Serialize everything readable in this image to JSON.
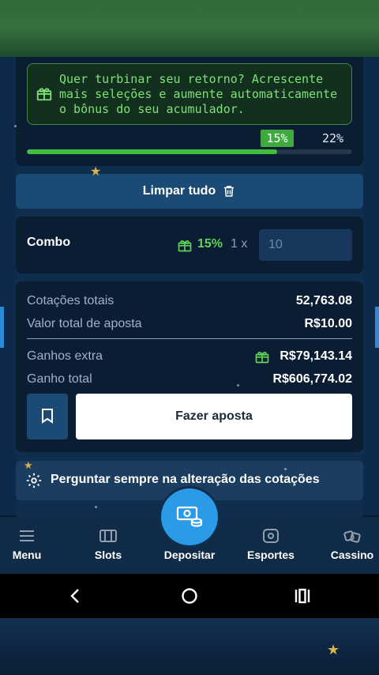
{
  "promo": {
    "message": "Quer turbinar seu retorno? Acrescente mais seleções e aumente automaticamente o bônus do seu acumulador.",
    "current_percent": "15%",
    "max_percent": "22%",
    "progress": 0.77
  },
  "actions": {
    "clear_all": "Limpar tudo"
  },
  "combo": {
    "label": "Combo",
    "bonus_percent": "15%",
    "multiplier": "1 x",
    "stake_placeholder": "10"
  },
  "summary": {
    "total_odds_label": "Cotações totais",
    "total_odds_value": "52,763.08",
    "total_stake_label": "Valor total de aposta",
    "total_stake_value": "R$10.00",
    "extra_winnings_label": "Ganhos extra",
    "extra_winnings_value": "R$79,143.14",
    "total_win_label": "Ganho total",
    "total_win_value": "R$606,774.02",
    "place_bet_label": "Fazer aposta"
  },
  "settings": {
    "odds_change_label": "Perguntar sempre na alteração das cotações"
  },
  "nav": {
    "items": [
      {
        "label": "Menu",
        "icon": "menu-icon"
      },
      {
        "label": "Slots",
        "icon": "slots-icon"
      },
      {
        "label": "Depositar",
        "icon": "deposit-icon"
      },
      {
        "label": "Esportes",
        "icon": "sports-icon"
      },
      {
        "label": "Cassino",
        "icon": "casino-icon"
      }
    ]
  },
  "colors": {
    "accent_green": "#3fbf3d",
    "primary_blue": "#2b9be8",
    "panel": "#0b1d33"
  }
}
